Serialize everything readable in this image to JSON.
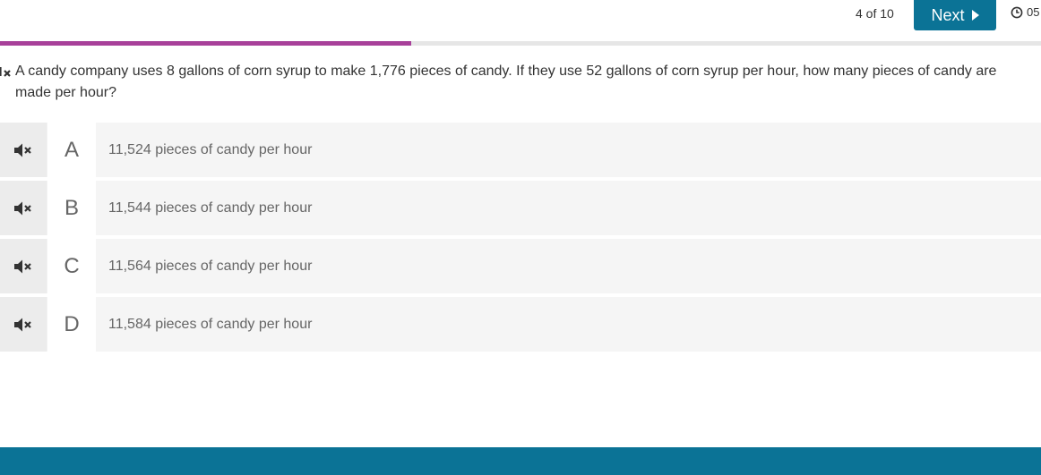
{
  "header": {
    "counter": "4 of 10",
    "next_label": "Next",
    "timer": "05"
  },
  "progress": {
    "fraction": 0.395
  },
  "question": {
    "text": "A candy company uses 8 gallons of corn syrup to make 1,776 pieces of candy. If they use 52 gallons of corn syrup per hour, how many pieces of candy are made per hour?"
  },
  "choices": [
    {
      "letter": "A",
      "text": "11,524 pieces of candy per hour"
    },
    {
      "letter": "B",
      "text": "11,544 pieces of candy per hour"
    },
    {
      "letter": "C",
      "text": "11,564 pieces of candy per hour"
    },
    {
      "letter": "D",
      "text": "11,584 pieces of candy per hour"
    }
  ],
  "colors": {
    "brand": "#0b7396",
    "progress": "#a8409a"
  },
  "icons": {
    "audio": "speaker-muted-icon",
    "timer": "clock-icon",
    "next": "caret-right-icon"
  }
}
